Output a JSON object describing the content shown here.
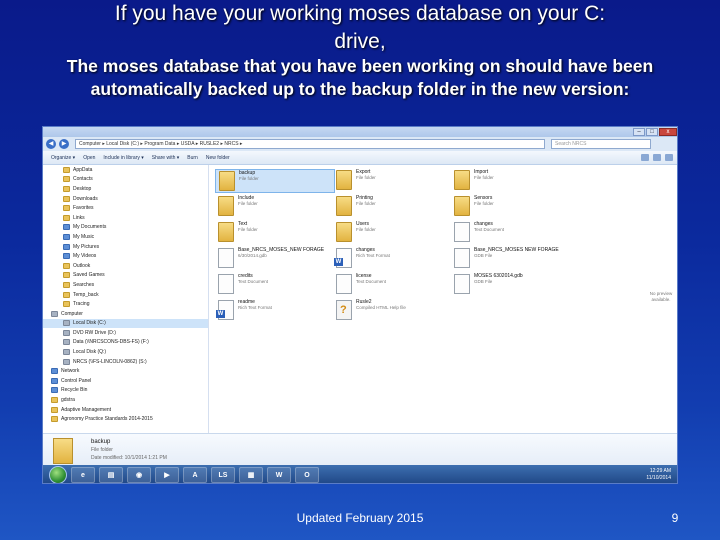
{
  "slide": {
    "title_line1": "If you have your working moses database on your C:",
    "title_line2": "drive,",
    "body": "The moses database that you have been working on should have been automatically backed up to the backup folder in the new version:",
    "footer": "Updated February 2015",
    "page_number": "9"
  },
  "explorer": {
    "address": "Computer  ▸  Local Disk (C:)  ▸  Program Data  ▸  USDA  ▸  RUSLE2  ▸  NRCS  ▸",
    "search_placeholder": "Search NRCS",
    "window_controls": [
      "–",
      "□",
      "x"
    ],
    "toolbar": [
      "Organize ▾",
      "Open",
      "Include in library ▾",
      "Share with ▾",
      "Burn",
      "New folder"
    ],
    "nav_items": [
      {
        "label": "AppData",
        "icon": "folder"
      },
      {
        "label": "Contacts",
        "icon": "folder"
      },
      {
        "label": "Desktop",
        "icon": "folder"
      },
      {
        "label": "Downloads",
        "icon": "folder"
      },
      {
        "label": "Favorites",
        "icon": "folder"
      },
      {
        "label": "Links",
        "icon": "folder"
      },
      {
        "label": "My Documents",
        "icon": "blue"
      },
      {
        "label": "My Music",
        "icon": "blue"
      },
      {
        "label": "My Pictures",
        "icon": "blue"
      },
      {
        "label": "My Videos",
        "icon": "blue"
      },
      {
        "label": "Outlook",
        "icon": "folder"
      },
      {
        "label": "Saved Games",
        "icon": "folder"
      },
      {
        "label": "Searches",
        "icon": "folder"
      },
      {
        "label": "Temp_back",
        "icon": "folder"
      },
      {
        "label": "Tracing",
        "icon": "folder"
      },
      {
        "label": "Computer",
        "icon": "drive"
      },
      {
        "label": "Local Disk (C:)",
        "icon": "drive",
        "selected": true
      },
      {
        "label": "DVD RW Drive (D:)",
        "icon": "drive"
      },
      {
        "label": "Data (\\\\NRCSCONS-DBS-FS) (F:)",
        "icon": "drive"
      },
      {
        "label": "Local Disk (Q:)",
        "icon": "drive"
      },
      {
        "label": "NRCS (\\\\FS-LINCOLN-0862) (S:)",
        "icon": "drive"
      },
      {
        "label": "Network",
        "icon": "blue"
      },
      {
        "label": "Control Panel",
        "icon": "blue"
      },
      {
        "label": "Recycle Bin",
        "icon": "blue"
      },
      {
        "label": "gdstra",
        "icon": "folder"
      },
      {
        "label": "Adaptive Management",
        "icon": "folder"
      },
      {
        "label": "Agronomy Practice Standards 2014-2015",
        "icon": "folder"
      }
    ],
    "files": [
      {
        "name": "backup",
        "type": "File folder",
        "icon": "folder",
        "selected": true
      },
      {
        "name": "Export",
        "type": "File folder",
        "icon": "folder"
      },
      {
        "name": "Import",
        "type": "File folder",
        "icon": "folder"
      },
      {
        "name": "Include",
        "type": "File folder",
        "icon": "folder"
      },
      {
        "name": "Printing",
        "type": "File folder",
        "icon": "folder"
      },
      {
        "name": "Sensors",
        "type": "File folder",
        "icon": "folder"
      },
      {
        "name": "Text",
        "type": "File folder",
        "icon": "folder"
      },
      {
        "name": "Users",
        "type": "File folder",
        "icon": "folder"
      },
      {
        "name": "Base_NRCS_MOSES NEW FORAGE",
        "type": "GDB File",
        "icon": "doc"
      },
      {
        "name": "Base_NRCS_MOSES_NEW FORAGE",
        "type": "6/30/2014.gdb",
        "icon": "doc"
      },
      {
        "name": "changes",
        "type": "Rich Text Format",
        "icon": "word"
      },
      {
        "name": "changes",
        "type": "Text Document",
        "icon": "doc"
      },
      {
        "name": "credits",
        "type": "Text Document",
        "icon": "doc"
      },
      {
        "name": "license",
        "type": "Text Document",
        "icon": "doc"
      },
      {
        "name": "MOSES 6302014.gdb",
        "type": "GDB File",
        "icon": "doc"
      },
      {
        "name": "readme",
        "type": "Rich Text Format",
        "icon": "word"
      },
      {
        "name": "Rusle2",
        "type": "Compiled HTML Help file",
        "icon": "help"
      }
    ],
    "preview_note": "No preview available.",
    "details": {
      "name": "backup",
      "type": "File folder",
      "modified": "Date modified: 10/1/2014 1:21 PM"
    },
    "taskbar": {
      "apps": [
        "e",
        "▤",
        "◉",
        "▶",
        "A",
        "LS",
        "▦",
        "W",
        "O"
      ],
      "time": "12:29 AM",
      "date": "11/10/2014"
    }
  }
}
